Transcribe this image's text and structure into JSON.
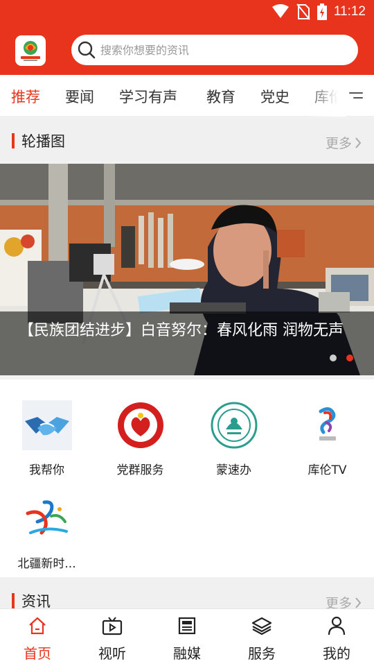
{
  "status_bar": {
    "time": "11:12"
  },
  "header": {
    "logo_icon": "app-logo",
    "search": {
      "placeholder": "搜索你想要的资讯",
      "value": ""
    }
  },
  "tabs": [
    {
      "label": "推荐",
      "active": true
    },
    {
      "label": "要闻"
    },
    {
      "label": "学习有声"
    },
    {
      "label": "教育"
    },
    {
      "label": "党史"
    },
    {
      "label": "库伦"
    }
  ],
  "carousel_section": {
    "title": "轮播图",
    "more": "更多",
    "slide": {
      "caption": "【民族团结进步】白音努尔：春风化雨  润物无声"
    },
    "slide_count": 2,
    "active_slide": 2
  },
  "services": [
    {
      "label": "我帮你",
      "icon": "handshake-icon"
    },
    {
      "label": "党群服务",
      "icon": "party-service-icon"
    },
    {
      "label": "蒙速办",
      "icon": "mengsuban-icon"
    },
    {
      "label": "库伦TV",
      "icon": "kulun-tv-icon"
    },
    {
      "label": "北疆新时...",
      "icon": "beijiang-icon"
    }
  ],
  "news_section": {
    "title": "资讯",
    "more": "更多"
  },
  "bottom_nav": [
    {
      "label": "首页",
      "icon": "home-icon",
      "active": true
    },
    {
      "label": "视听",
      "icon": "tv-icon"
    },
    {
      "label": "融媒",
      "icon": "newspaper-icon"
    },
    {
      "label": "服务",
      "icon": "layers-icon"
    },
    {
      "label": "我的",
      "icon": "user-icon"
    }
  ],
  "colors": {
    "brand": "#e8341c",
    "active_text": "#e8341c",
    "inactive_text": "#222222"
  }
}
